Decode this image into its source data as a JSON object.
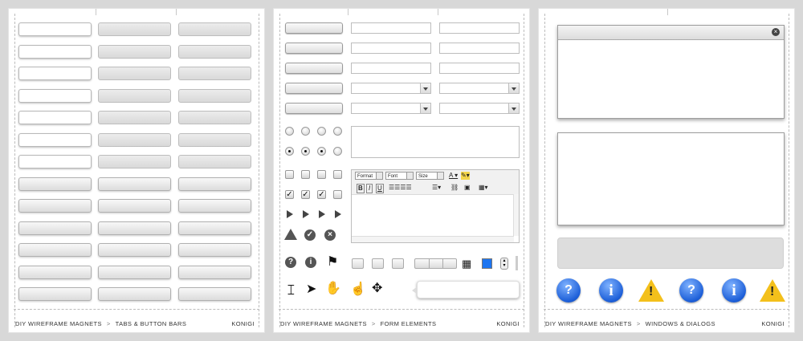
{
  "sheets": [
    {
      "breadcrumb": {
        "root": "DIY WIREFRAME MAGNETS",
        "sep": ">",
        "section": "TABS & BUTTON BARS"
      },
      "brand": "KONIGI"
    },
    {
      "breadcrumb": {
        "root": "DIY WIREFRAME MAGNETS",
        "sep": ">",
        "section": "FORM ELEMENTS"
      },
      "brand": "KONIGI"
    },
    {
      "breadcrumb": {
        "root": "DIY WIREFRAME MAGNETS",
        "sep": ">",
        "section": "WINDOWS & DIALOGS"
      },
      "brand": "KONIGI"
    }
  ],
  "editor": {
    "format_label": "Format",
    "font_label": "Font",
    "size_label": "Size",
    "bold": "B",
    "italic": "I",
    "underline": "U"
  },
  "icons": {
    "info": "i",
    "question": "?",
    "warning": "!",
    "close": "×",
    "check": "✓"
  },
  "colors": {
    "accent_blue": "#1d75f0",
    "warning_yellow": "#f3c01b",
    "alert_gray": "#555555"
  }
}
